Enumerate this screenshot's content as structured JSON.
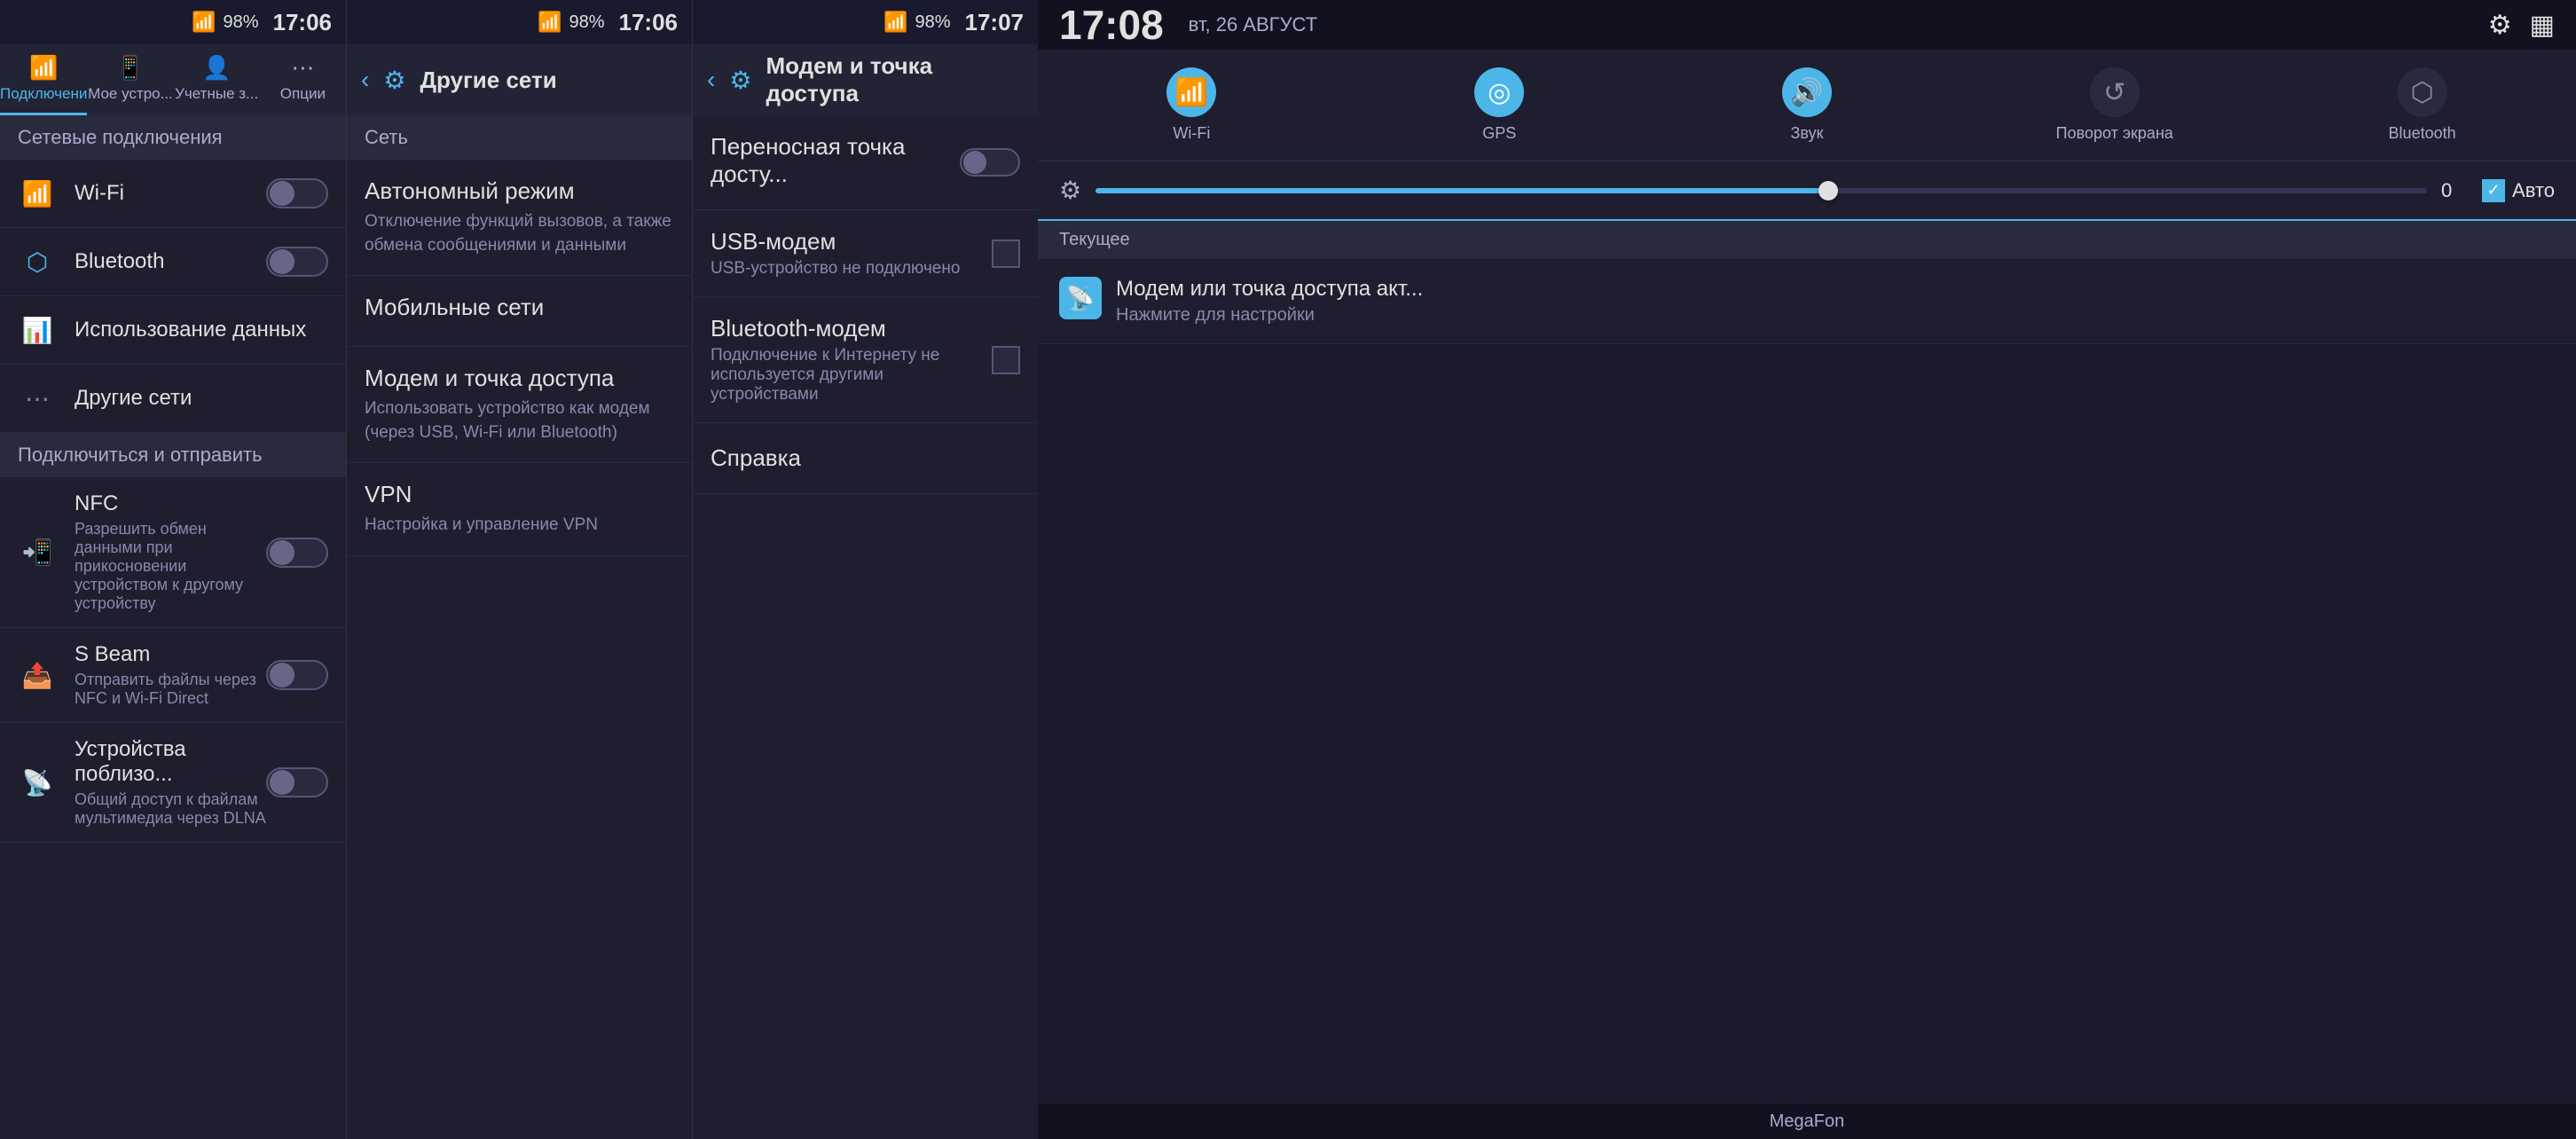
{
  "panel1": {
    "statusBar": {
      "signal": "▲▲▲",
      "battery": "98%",
      "time": "17:06"
    },
    "tabs": [
      {
        "id": "connections",
        "label": "Подключени",
        "icon": "📶",
        "active": true
      },
      {
        "id": "mydevice",
        "label": "Мое устро...",
        "icon": "📱",
        "active": false
      },
      {
        "id": "accounts",
        "label": "Учетные з...",
        "icon": "👤",
        "active": false
      },
      {
        "id": "options",
        "label": "Опции",
        "icon": "⋯",
        "active": false
      }
    ],
    "sectionNetwork": "Сетевые подключения",
    "items": [
      {
        "id": "wifi",
        "label": "Wi-Fi",
        "icon": "wifi",
        "toggle": true,
        "toggleOn": false
      },
      {
        "id": "bluetooth",
        "label": "Bluetooth",
        "icon": "bluetooth",
        "toggle": true,
        "toggleOn": false
      },
      {
        "id": "dataUsage",
        "label": "Использование данных",
        "icon": "data",
        "toggle": false
      },
      {
        "id": "otherNets",
        "label": "Другие сети",
        "icon": "other",
        "toggle": false
      }
    ],
    "sectionConnect": "Подключиться и отправить",
    "connectItems": [
      {
        "id": "nfc",
        "label": "NFC",
        "sub": "Разрешить обмен данными при прикосновении устройством к другому устройству",
        "icon": "nfc",
        "toggle": true,
        "toggleOn": false
      },
      {
        "id": "sbeam",
        "label": "S Beam",
        "sub": "Отправить файлы через NFC и Wi-Fi Direct",
        "icon": "sbeam",
        "toggle": true,
        "toggleOn": false
      },
      {
        "id": "nearby",
        "label": "Устройства поблизо...",
        "sub": "Общий доступ к файлам мультимедиа через DLNA",
        "icon": "nearby",
        "toggle": true,
        "toggleOn": false
      }
    ]
  },
  "panel2": {
    "statusBar": {
      "signal": "▲▲▲",
      "battery": "98%",
      "time": "17:06"
    },
    "backBtn": "‹",
    "title": "Другие сети",
    "sectionNet": "Сеть",
    "items": [
      {
        "id": "autonomy",
        "title": "Автономный режим",
        "sub": "Отключение функций вызовов, а также обмена сообщениями и данными",
        "hasCheckbox": true
      },
      {
        "id": "mobile",
        "title": "Мобильные сети",
        "sub": "",
        "hasCheckbox": false
      },
      {
        "id": "modem",
        "title": "Модем и точка доступа",
        "sub": "Использовать устройство как модем (через USB, Wi-Fi или Bluetooth)",
        "hasCheckbox": false
      },
      {
        "id": "vpn",
        "title": "VPN",
        "sub": "Настройка и управление VPN",
        "hasCheckbox": false
      }
    ]
  },
  "panel3": {
    "statusBar": {
      "signal": "▲▲▲",
      "battery": "98%",
      "time": "17:07"
    },
    "backBtn": "‹",
    "title": "Модем и точка доступа",
    "items": [
      {
        "id": "hotspot",
        "title": "Переносная точка досту...",
        "sub": "",
        "hasToggle": true,
        "toggleOn": false
      },
      {
        "id": "usbModem",
        "title": "USB-модем",
        "sub": "USB-устройство не подключено",
        "hasCheckbox": true,
        "disabled": true
      },
      {
        "id": "btModem",
        "title": "Bluetooth-модем",
        "sub": "Подключение к Интернету не используется другими устройствами",
        "hasCheckbox": true,
        "disabled": false
      }
    ],
    "справка": "Справка"
  },
  "panel4": {
    "time": "17:08",
    "date": "вт, 26 АВГУСТ",
    "rightIcons": [
      "⚙",
      "▦"
    ],
    "quickToggles": [
      {
        "id": "wifi",
        "icon": "📶",
        "label": "Wi-Fi",
        "active": true
      },
      {
        "id": "gps",
        "icon": "◎",
        "label": "GPS",
        "active": true
      },
      {
        "id": "sound",
        "icon": "🔊",
        "label": "Звук",
        "active": true
      },
      {
        "id": "rotate",
        "icon": "↺",
        "label": "Поворот экрана",
        "active": false
      },
      {
        "id": "bluetooth",
        "icon": "⬡",
        "label": "Bluetooth",
        "active": false
      }
    ],
    "brightness": {
      "value": "0",
      "autoLabel": "Авто",
      "sliderPercent": 55
    },
    "currentSection": "Текущее",
    "notifications": [
      {
        "id": "hotspotNotif",
        "icon": "📡",
        "title": "Модем или точка доступа акт...",
        "sub": "Нажмите для настройки"
      }
    ],
    "carrier": "MegaFon"
  }
}
